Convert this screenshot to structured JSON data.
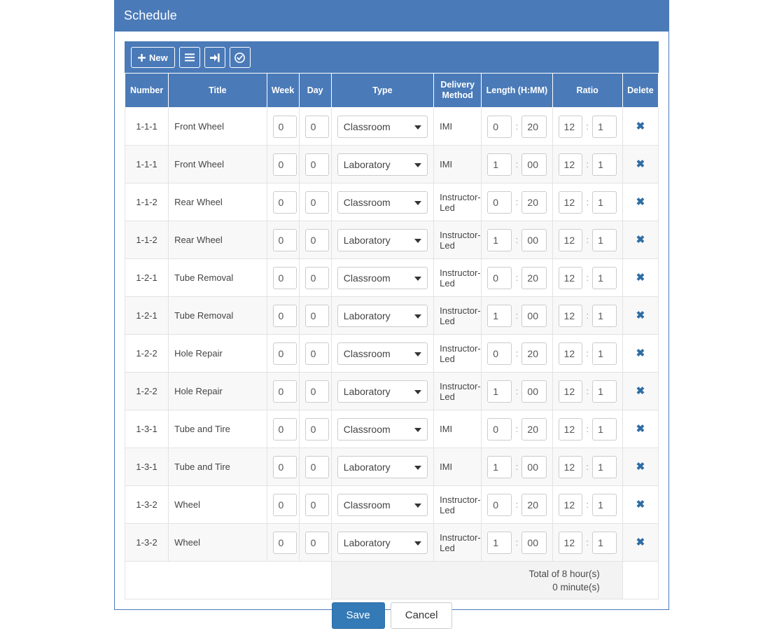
{
  "panel": {
    "title": "Schedule"
  },
  "toolbar": {
    "new_label": "New",
    "buttons": [
      {
        "name": "new",
        "label": "New",
        "icon": "plus-icon"
      },
      {
        "name": "list",
        "label": "",
        "icon": "hamburger-icon"
      },
      {
        "name": "import",
        "label": "",
        "icon": "sign-in-icon"
      },
      {
        "name": "approve",
        "label": "",
        "icon": "check-circle-icon"
      }
    ]
  },
  "table": {
    "headers": {
      "number": "Number",
      "title": "Title",
      "week": "Week",
      "day": "Day",
      "type": "Type",
      "delivery_method": "Delivery Method",
      "length": "Length (H:MM)",
      "ratio": "Ratio",
      "delete": "Delete"
    },
    "rows": [
      {
        "number": "1-1-1",
        "title": "Front Wheel",
        "week": "0",
        "day": "0",
        "type": "Classroom",
        "delivery": "IMI",
        "length_h": "0",
        "length_m": "20",
        "ratio_a": "12",
        "ratio_b": "1"
      },
      {
        "number": "1-1-1",
        "title": "Front Wheel",
        "week": "0",
        "day": "0",
        "type": "Laboratory",
        "delivery": "IMI",
        "length_h": "1",
        "length_m": "00",
        "ratio_a": "12",
        "ratio_b": "1"
      },
      {
        "number": "1-1-2",
        "title": "Rear Wheel",
        "week": "0",
        "day": "0",
        "type": "Classroom",
        "delivery": "Instructor-Led",
        "length_h": "0",
        "length_m": "20",
        "ratio_a": "12",
        "ratio_b": "1"
      },
      {
        "number": "1-1-2",
        "title": "Rear Wheel",
        "week": "0",
        "day": "0",
        "type": "Laboratory",
        "delivery": "Instructor-Led",
        "length_h": "1",
        "length_m": "00",
        "ratio_a": "12",
        "ratio_b": "1"
      },
      {
        "number": "1-2-1",
        "title": "Tube Removal",
        "week": "0",
        "day": "0",
        "type": "Classroom",
        "delivery": "Instructor-Led",
        "length_h": "0",
        "length_m": "20",
        "ratio_a": "12",
        "ratio_b": "1"
      },
      {
        "number": "1-2-1",
        "title": "Tube Removal",
        "week": "0",
        "day": "0",
        "type": "Laboratory",
        "delivery": "Instructor-Led",
        "length_h": "1",
        "length_m": "00",
        "ratio_a": "12",
        "ratio_b": "1"
      },
      {
        "number": "1-2-2",
        "title": "Hole Repair",
        "week": "0",
        "day": "0",
        "type": "Classroom",
        "delivery": "Instructor-Led",
        "length_h": "0",
        "length_m": "20",
        "ratio_a": "12",
        "ratio_b": "1"
      },
      {
        "number": "1-2-2",
        "title": "Hole Repair",
        "week": "0",
        "day": "0",
        "type": "Laboratory",
        "delivery": "Instructor-Led",
        "length_h": "1",
        "length_m": "00",
        "ratio_a": "12",
        "ratio_b": "1"
      },
      {
        "number": "1-3-1",
        "title": "Tube and Tire",
        "week": "0",
        "day": "0",
        "type": "Classroom",
        "delivery": "IMI",
        "length_h": "0",
        "length_m": "20",
        "ratio_a": "12",
        "ratio_b": "1"
      },
      {
        "number": "1-3-1",
        "title": "Tube and Tire",
        "week": "0",
        "day": "0",
        "type": "Laboratory",
        "delivery": "IMI",
        "length_h": "1",
        "length_m": "00",
        "ratio_a": "12",
        "ratio_b": "1"
      },
      {
        "number": "1-3-2",
        "title": "Wheel",
        "week": "0",
        "day": "0",
        "type": "Classroom",
        "delivery": "Instructor-Led",
        "length_h": "0",
        "length_m": "20",
        "ratio_a": "12",
        "ratio_b": "1"
      },
      {
        "number": "1-3-2",
        "title": "Wheel",
        "week": "0",
        "day": "0",
        "type": "Laboratory",
        "delivery": "Instructor-Led",
        "length_h": "1",
        "length_m": "00",
        "ratio_a": "12",
        "ratio_b": "1"
      }
    ],
    "time_separator": ":",
    "ratio_separator": ":",
    "delete_glyph": "✖",
    "footer": {
      "total_line1": "Total of 8 hour(s)",
      "total_line2": "0 minute(s)"
    }
  },
  "actions": {
    "save_label": "Save",
    "cancel_label": "Cancel"
  },
  "colors": {
    "brand_blue": "#4a7ab8",
    "save_blue": "#337ab7",
    "delete_blue": "#2e6da4",
    "row_stripe": "#f8f8f8",
    "footer_bg": "#f3f3f3"
  }
}
